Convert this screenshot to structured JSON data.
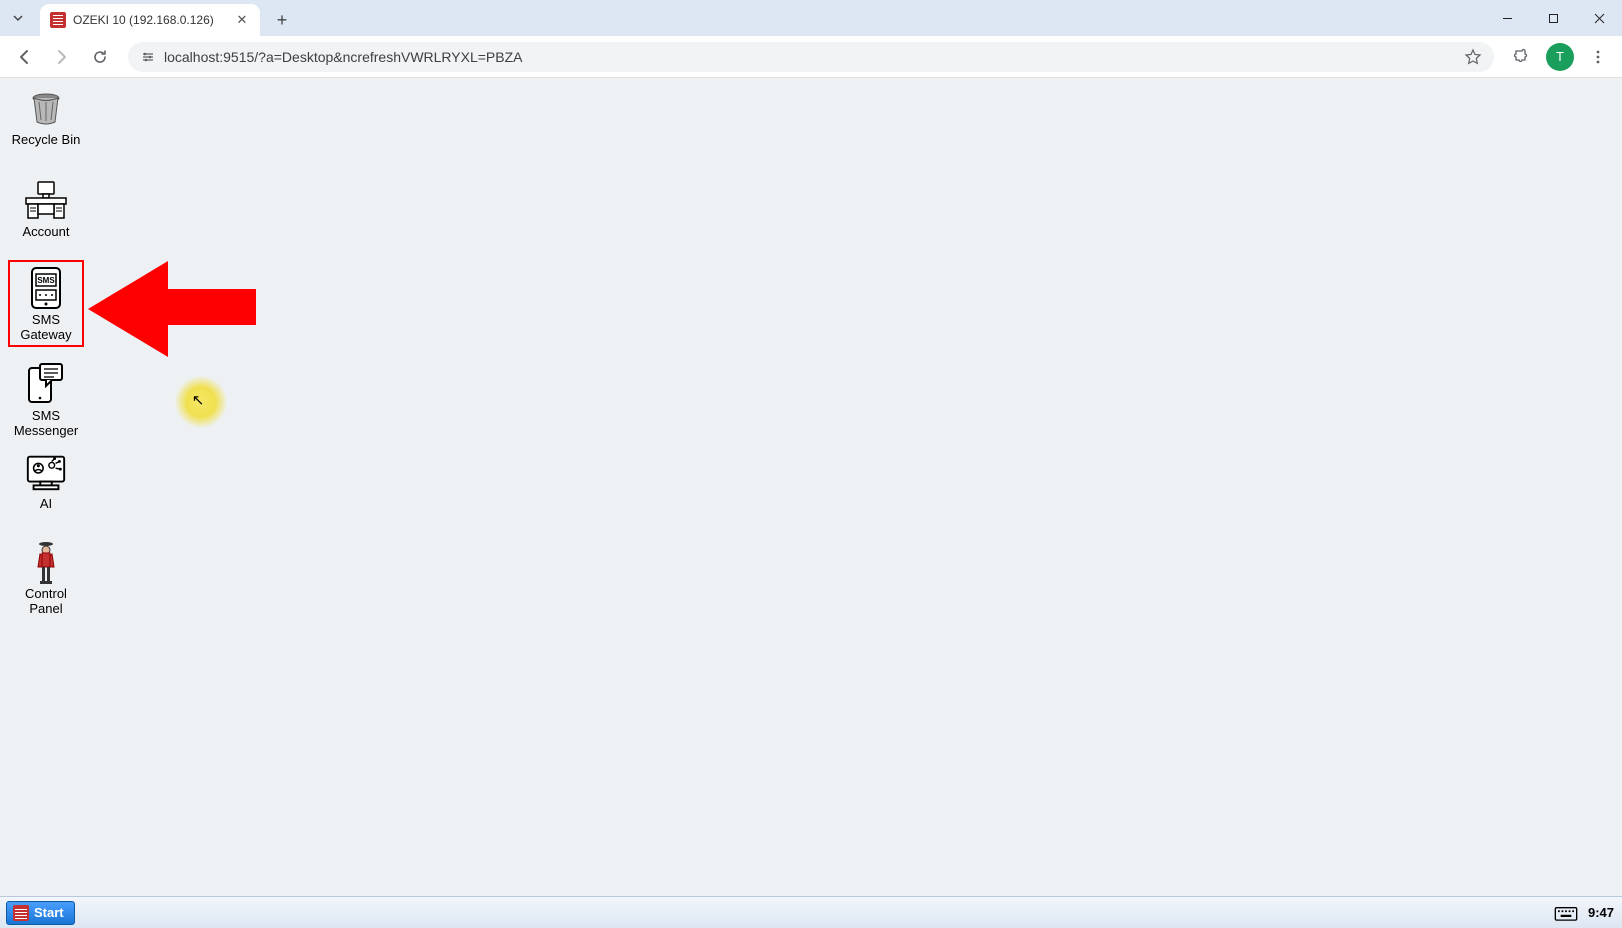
{
  "browser": {
    "tab_title": "OZEKI 10 (192.168.0.126)",
    "url": "localhost:9515/?a=Desktop&ncrefreshVWRLRYXL=PBZA",
    "avatar_letter": "T"
  },
  "desktop": {
    "icons": [
      {
        "id": "recycle-bin",
        "label": "Recycle Bin"
      },
      {
        "id": "account",
        "label": "Account"
      },
      {
        "id": "sms-gateway",
        "label": "SMS\nGateway"
      },
      {
        "id": "sms-messenger",
        "label": "SMS\nMessenger"
      },
      {
        "id": "ai",
        "label": "AI"
      },
      {
        "id": "control-panel",
        "label": "Control\nPanel"
      }
    ]
  },
  "taskbar": {
    "start_label": "Start",
    "clock": "9:47"
  }
}
